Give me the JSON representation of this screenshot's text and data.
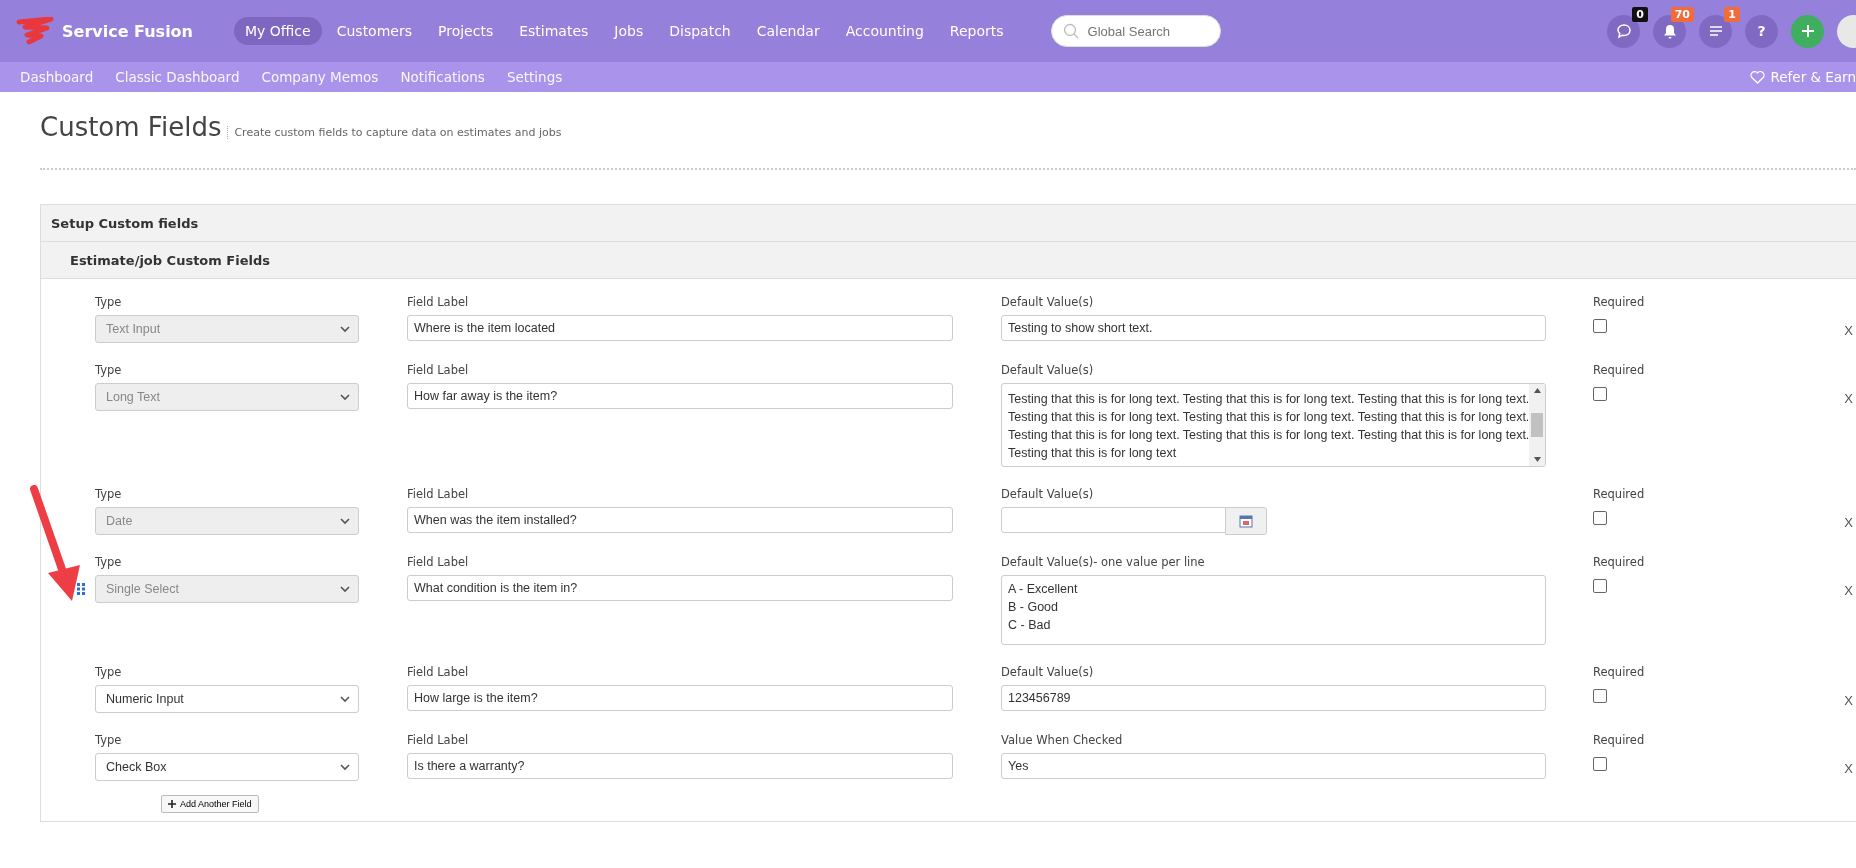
{
  "brand": {
    "name": "Service Fusion"
  },
  "nav": [
    {
      "label": "My Office",
      "selected": true
    },
    {
      "label": "Customers",
      "selected": false
    },
    {
      "label": "Projects",
      "selected": false
    },
    {
      "label": "Estimates",
      "selected": false
    },
    {
      "label": "Jobs",
      "selected": false
    },
    {
      "label": "Dispatch",
      "selected": false
    },
    {
      "label": "Calendar",
      "selected": false
    },
    {
      "label": "Accounting",
      "selected": false
    },
    {
      "label": "Reports",
      "selected": false
    }
  ],
  "search": {
    "placeholder": "Global Search"
  },
  "header_icons": [
    {
      "kind": "chat",
      "badge": "0",
      "color": "#111111"
    },
    {
      "kind": "bell",
      "badge": "70",
      "color": "#f26b3a"
    },
    {
      "kind": "list",
      "badge": "1",
      "color": "#f26b3a"
    },
    {
      "kind": "help",
      "text": "?"
    },
    {
      "kind": "add"
    },
    {
      "kind": "avatar"
    }
  ],
  "subnav": [
    {
      "label": "Dashboard"
    },
    {
      "label": "Classic Dashboard"
    },
    {
      "label": "Company Memos"
    },
    {
      "label": "Notifications"
    },
    {
      "label": "Settings"
    }
  ],
  "refer": {
    "label": "Refer & Earn"
  },
  "page": {
    "title": "Custom Fields",
    "subtitle": "Create custom fields to capture data on estimates and jobs"
  },
  "panel": {
    "title": "Setup Custom fields",
    "subtitle": "Estimate/job Custom Fields"
  },
  "fields": [
    {
      "kind": "text",
      "type_label": "Type",
      "type": "Text Input",
      "type_disabled": true,
      "label_caption": "Field Label",
      "label": "Where is the item located",
      "value_caption": "Default Value(s)",
      "value": "Testing to show short text.",
      "required_caption": "Required",
      "required": false,
      "remove": "X",
      "drag_handle": false
    },
    {
      "kind": "scroll",
      "type_label": "Type",
      "type": "Long Text",
      "type_disabled": true,
      "label_caption": "Field Label",
      "label": "How far away is the item?",
      "value_caption": "Default Value(s)",
      "lines": [
        "Testing that this is for long text. Testing that this is for long text. Testing that this is for long text.",
        "Testing that this is for long text. Testing that this is for long text. Testing that this is for long text.",
        "Testing that this is for long text. Testing that this is for long text. Testing that this is for long text.",
        "Testing that this is for long text"
      ],
      "required_caption": "Required",
      "required": false,
      "remove": "X",
      "drag_handle": false
    },
    {
      "kind": "date",
      "type_label": "Type",
      "type": "Date",
      "type_disabled": true,
      "label_caption": "Field Label",
      "label": "When was the item installed?",
      "value_caption": "Default Value(s)",
      "required_caption": "Required",
      "required": false,
      "remove": "X",
      "drag_handle": false
    },
    {
      "kind": "options",
      "type_label": "Type",
      "type": "Single Select",
      "type_disabled": true,
      "label_caption": "Field Label",
      "label": "What condition is the item in?",
      "value_caption": "Default Value(s)- one value per line",
      "lines": [
        "A - Excellent",
        "B - Good",
        "C - Bad"
      ],
      "required_caption": "Required",
      "required": false,
      "remove": "X",
      "drag_handle": true
    },
    {
      "kind": "text",
      "type_label": "Type",
      "type": "Numeric Input",
      "type_disabled": false,
      "label_caption": "Field Label",
      "label": "How large is the item?",
      "value_caption": "Default Value(s)",
      "value": "123456789",
      "required_caption": "Required",
      "required": false,
      "remove": "X",
      "drag_handle": false
    },
    {
      "kind": "text",
      "type_label": "Type",
      "type": "Check Box",
      "type_disabled": false,
      "label_caption": "Field Label",
      "label": "Is there a warranty?",
      "value_caption": "Value When Checked",
      "value": "Yes",
      "required_caption": "Required",
      "required": false,
      "remove": "X",
      "drag_handle": false
    }
  ],
  "add_button": {
    "label": "Add Another Field"
  }
}
